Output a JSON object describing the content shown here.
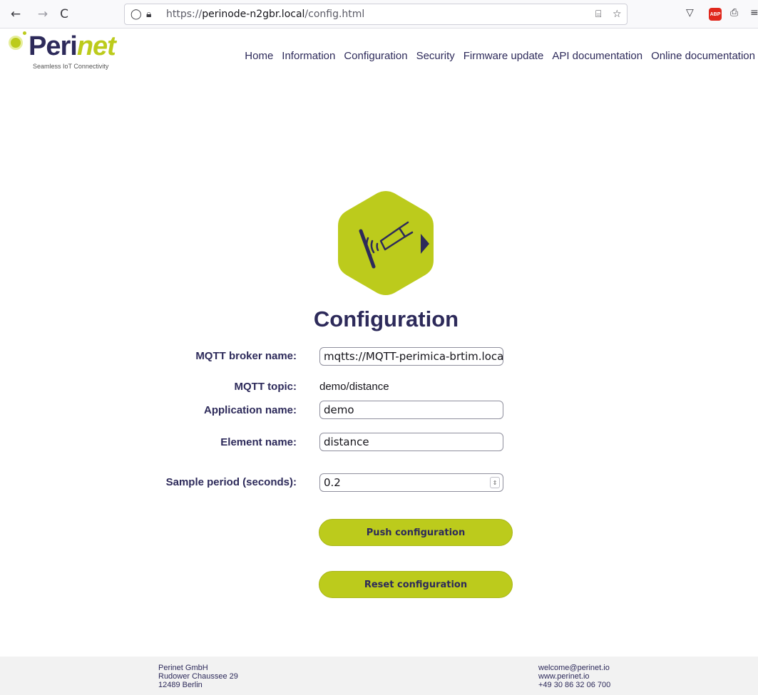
{
  "browser": {
    "back_icon": "←",
    "forward_icon": "→",
    "reload_icon": "C",
    "url_prefix": "https://",
    "url_host": "perinode-n2gbr.local",
    "url_path": "/config.html",
    "abp_label": "ABP"
  },
  "header": {
    "logo_main": "Peri",
    "logo_accent": "net",
    "logo_tagline": "Seamless IoT Connectivity",
    "nav": [
      "Home",
      "Information",
      "Configuration",
      "Security",
      "Firmware update",
      "API documentation",
      "Online documentation"
    ]
  },
  "colors": {
    "brand_green": "#bccb1c",
    "brand_navy": "#2d2a5a"
  },
  "main": {
    "title": "Configuration",
    "broker_label": "MQTT broker name:",
    "broker_value": "mqtts://MQTT-perimica-brtim.local",
    "topic_label": "MQTT topic:",
    "topic_value": "demo/distance",
    "app_label": "Application name:",
    "app_value": "demo",
    "element_label": "Element name:",
    "element_value": "distance",
    "period_label": "Sample period (seconds):",
    "period_value": "0.2",
    "push_label": "Push configuration",
    "reset_label": "Reset configuration"
  },
  "footer": {
    "company": "Perinet GmbH",
    "street": "Rudower Chaussee 29",
    "city": "12489 Berlin",
    "email": "welcome@perinet.io",
    "web": "www.perinet.io",
    "phone": "+49 30 86 32 06 700"
  }
}
